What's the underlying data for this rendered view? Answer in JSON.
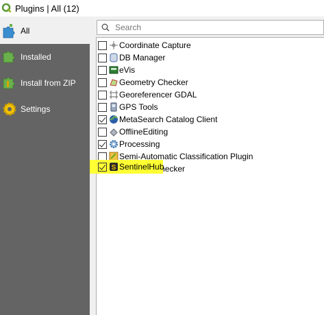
{
  "window": {
    "title": "Plugins | All (12)"
  },
  "sidebar": {
    "items": [
      {
        "label": "All",
        "icon": "puzzle-all-icon",
        "active": true
      },
      {
        "label": "Installed",
        "icon": "puzzle-installed-icon",
        "active": false
      },
      {
        "label": "Install from ZIP",
        "icon": "zip-install-icon",
        "active": false
      },
      {
        "label": "Settings",
        "icon": "gear-icon",
        "active": false
      }
    ]
  },
  "search": {
    "placeholder": "Search",
    "value": ""
  },
  "plugins": [
    {
      "label": "Coordinate Capture",
      "checked": false,
      "icon": "crosshair-icon"
    },
    {
      "label": "DB Manager",
      "checked": false,
      "icon": "database-icon"
    },
    {
      "label": "eVis",
      "checked": false,
      "icon": "evis-icon"
    },
    {
      "label": "Geometry Checker",
      "checked": false,
      "icon": "geometry-checker-icon"
    },
    {
      "label": "Georeferencer GDAL",
      "checked": false,
      "icon": "georeferencer-icon"
    },
    {
      "label": "GPS Tools",
      "checked": false,
      "icon": "gps-icon"
    },
    {
      "label": "MetaSearch Catalog Client",
      "checked": true,
      "icon": "metasearch-icon"
    },
    {
      "label": "OfflineEditing",
      "checked": false,
      "icon": "offline-editing-icon"
    },
    {
      "label": "Processing",
      "checked": true,
      "icon": "processing-gear-icon"
    },
    {
      "label": "Semi-Automatic Classification Plugin",
      "checked": false,
      "icon": "scp-icon"
    },
    {
      "label": "SentinelHub",
      "checked": true,
      "icon": "sentinelhub-icon",
      "highlighted": true
    },
    {
      "label": "Topology Checker",
      "checked": false,
      "icon": "topology-icon"
    }
  ],
  "colors": {
    "highlight": "#ffff33",
    "sidebar_bg": "#646464"
  }
}
